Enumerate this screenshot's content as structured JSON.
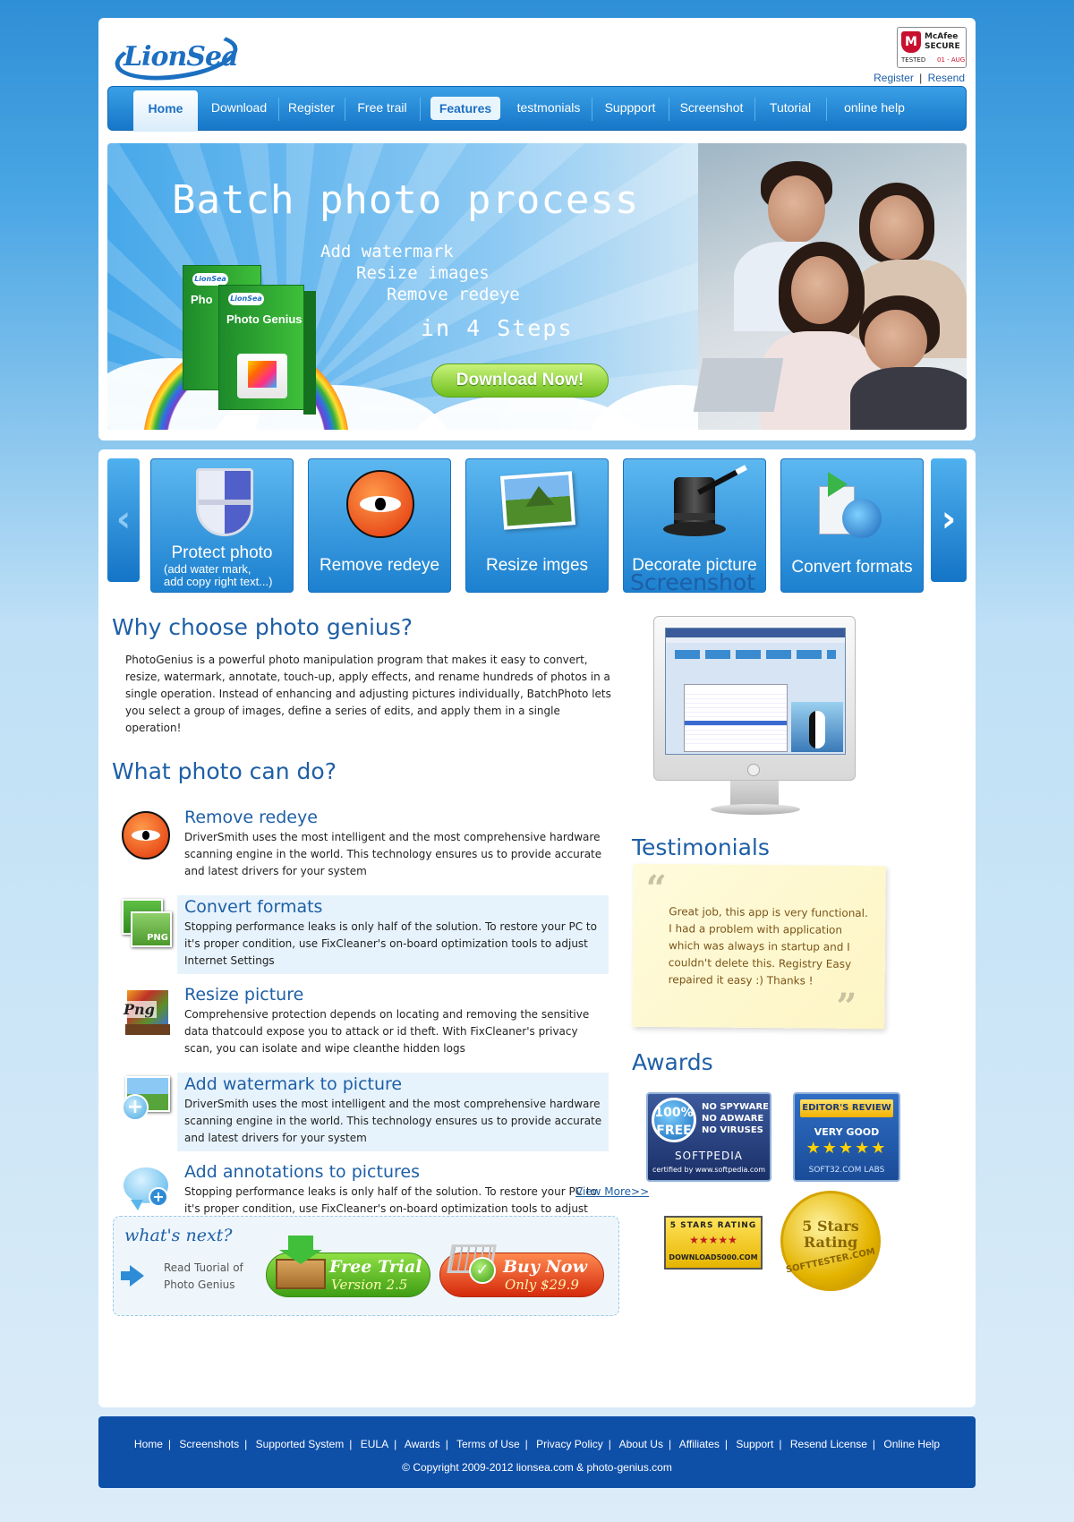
{
  "brand": {
    "logo_text": "LionSea"
  },
  "mcafee": {
    "brand": "McAfee",
    "secure": "SECURE",
    "tested": "TESTED",
    "date": "01 - AUG"
  },
  "top_links": {
    "register": "Register",
    "separator": "|",
    "resend": "Resend"
  },
  "nav": {
    "items": [
      "Home",
      "Download",
      "Register",
      "Free trail",
      "Features",
      "testmonials",
      "Suppport",
      "Screenshot",
      "Tutorial",
      "online help"
    ]
  },
  "banner": {
    "headline": "Batch photo process",
    "features": [
      "Add watermark",
      "Resize images",
      "Remove redeye"
    ],
    "steps": "in 4 Steps",
    "download_label": "Download Now!",
    "box_brand": "LionSea",
    "box_title": "Photo Genius",
    "box_back_title": "Pho"
  },
  "feature_strip": {
    "tiles": [
      {
        "label": "Protect photo",
        "sub1": "(add water mark,",
        "sub2": "add copy right text...)",
        "icon": "shield-icon"
      },
      {
        "label": "Remove redeye",
        "icon": "eye-icon"
      },
      {
        "label": "Resize imges",
        "icon": "photo-icon"
      },
      {
        "label": "Decorate picture",
        "icon": "magic-hat-icon"
      },
      {
        "label": "Convert formats",
        "icon": "convert-icon"
      }
    ]
  },
  "why": {
    "title": "Why choose photo genius?",
    "text": "PhotoGenius is a powerful photo manipulation program that makes it easy to convert, resize, watermark, annotate, touch-up, apply effects, and rename hundreds of photos in a single operation. Instead of enhancing and adjusting pictures individually, BatchPhoto lets you  select a group of  images, define a series of edits, and apply them in a single operation!"
  },
  "what": {
    "title": "What photo can do?",
    "items": [
      {
        "title": "Remove redeye",
        "desc": "DriverSmith uses the most intelligent and the most comprehensive hardware  scanning engine in the world. This technology ensures us to provide accurate and latest drivers  for your system"
      },
      {
        "title": "Convert formats",
        "desc": "Stopping performance leaks is only half of the solution. To restore your PC to it's proper condition, use FixCleaner's on-board optimization tools to adjust Internet Settings"
      },
      {
        "title": "Resize picture",
        "desc": "Comprehensive protection depends on locating and removing the sensitive data thatcould expose you to attack or id theft. With FixCleaner's privacy scan, you can isolate and wipe cleanthe hidden logs"
      },
      {
        "title": "Add watermark to picture",
        "desc": "DriverSmith uses the most intelligent and the most comprehensive hardware scanning engine in the world. This technology ensures us to provide accurate and latest drivers for your system"
      },
      {
        "title": "Add annotations to pictures",
        "desc": "Stopping performance leaks is only half of the solution. To restore your PC to it's proper condition, use FixCleaner's on-board optimization tools to adjust Internet Settings"
      }
    ],
    "view_more": "View More>>"
  },
  "next": {
    "title": "what's next?",
    "read1": "Read Tuorial of",
    "read2": "Photo Genius",
    "trial_l1": "Free Trial",
    "trial_l2": "Version 2.5",
    "buy_l1": "Buy Now",
    "buy_l2": "Only $29.9"
  },
  "screenshot": {
    "title": "Screenshot"
  },
  "testimonials": {
    "title": "Testimonials",
    "open_quote": "“",
    "close_quote": "”",
    "text": "Great job, this app is very functional. I had a problem with application which was always in startup and I couldn't delete this. Registry Easy repaired it easy :)  Thanks !"
  },
  "awards": {
    "title": "Awards",
    "softpedia": {
      "free_pct": "100%",
      "free": "FREE",
      "l1": "NO SPYWARE",
      "l2": "NO ADWARE",
      "l3": "NO VIRUSES",
      "name": "SOFTPEDIA",
      "cert": "certified by www.softpedia.com"
    },
    "soft32": {
      "head": "EDITOR'S REVIEW",
      "rating": "VERY GOOD",
      "stars": "★★★★★",
      "lab": "SOFT32.COM LABS"
    },
    "d5k": {
      "t1": "5 STARS RATING",
      "stars": "★★★★★",
      "t2": "DOWNLOAD5000.COM"
    },
    "softtester": {
      "t1": "5 Stars",
      "t2": "Rating",
      "site": "SOFTTESTER.COM"
    }
  },
  "footer": {
    "links": [
      "Home",
      "Screenshots",
      "Supported System",
      "EULA",
      "Awards",
      "Terms of Use",
      "Privacy Policy",
      "About Us",
      "Affiliates",
      "Support",
      "Resend License",
      "Online Help"
    ],
    "copyright": "© Copyright 2009-2012 lionsea.com & photo-genius.com"
  }
}
